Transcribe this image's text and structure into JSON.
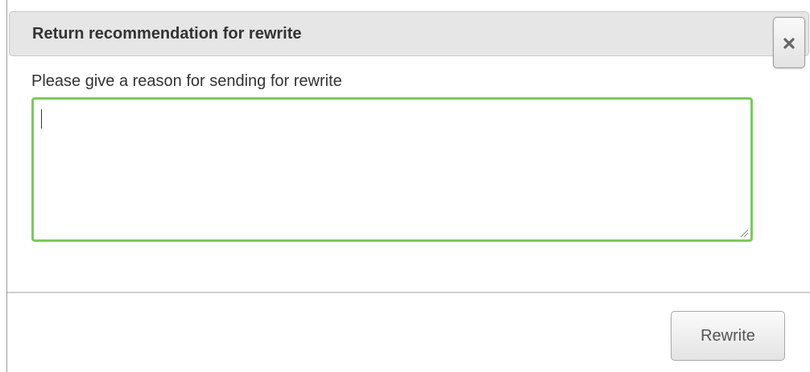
{
  "dialog": {
    "title": "Return recommendation for rewrite",
    "close_icon": "close-icon",
    "prompt_label": "Please give a reason for sending for rewrite",
    "reason": {
      "value": "",
      "focused": true,
      "focus_color": "#7acb5b"
    },
    "rewrite_label": "Rewrite"
  }
}
